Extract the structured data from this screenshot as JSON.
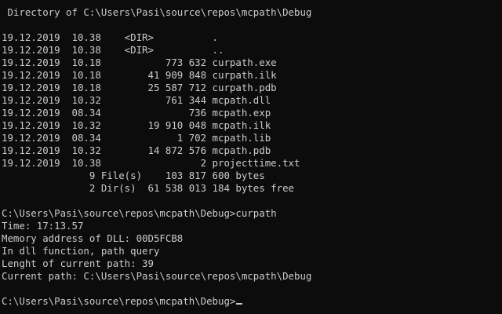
{
  "console": {
    "directory_header": " Directory of C:\\Users\\Pasi\\source\\repos\\mcpath\\Debug",
    "listing": [
      "19.12.2019  10.38    <DIR>          .",
      "19.12.2019  10.38    <DIR>          ..",
      "19.12.2019  10.18           773 632 curpath.exe",
      "19.12.2019  10.18        41 909 848 curpath.ilk",
      "19.12.2019  10.18        25 587 712 curpath.pdb",
      "19.12.2019  10.32           761 344 mcpath.dll",
      "19.12.2019  08.34               736 mcpath.exp",
      "19.12.2019  10.32        19 910 048 mcpath.ilk",
      "19.12.2019  08.34             1 702 mcpath.lib",
      "19.12.2019  10.32        14 872 576 mcpath.pdb",
      "19.12.2019  10.38                 2 projecttime.txt"
    ],
    "summary": [
      "               9 File(s)    103 817 600 bytes",
      "               2 Dir(s)  61 538 013 184 bytes free"
    ],
    "command_line": "C:\\Users\\Pasi\\source\\repos\\mcpath\\Debug>curpath",
    "program_output": [
      "Time: 17:13.57",
      "Memory address of DLL: 00D5FCB8",
      "In dll function, path query",
      "Lenght of current path: 39",
      "Current path: C:\\Users\\Pasi\\source\\repos\\mcpath\\Debug"
    ],
    "prompt": "C:\\Users\\Pasi\\source\\repos\\mcpath\\Debug>"
  },
  "colors": {
    "background": "#0c0c0c",
    "text": "#cccccc"
  }
}
